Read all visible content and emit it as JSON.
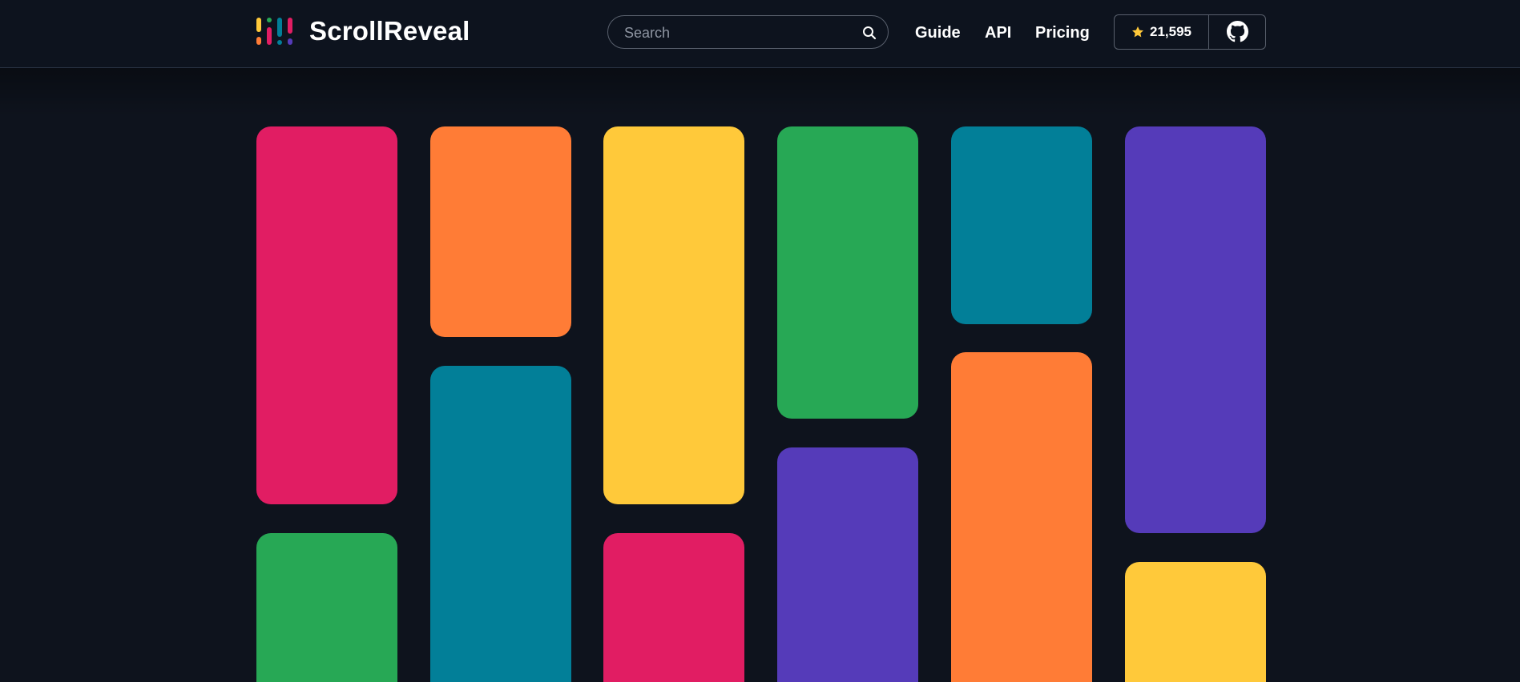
{
  "brand": {
    "name": "ScrollReveal",
    "logo_icon": "scrollreveal-logo-icon"
  },
  "search": {
    "placeholder": "Search",
    "value": "",
    "icon": "search-icon"
  },
  "nav": {
    "items": [
      {
        "label": "Guide"
      },
      {
        "label": "API"
      },
      {
        "label": "Pricing"
      }
    ]
  },
  "github": {
    "stars": "21,595",
    "star_icon": "star-icon",
    "link_icon": "github-icon"
  },
  "colors": {
    "background": "#0e131d",
    "pink": "#e11d63",
    "orange": "#ff7c36",
    "yellow": "#ffc93a",
    "green": "#27a855",
    "teal": "#027f98",
    "purple": "#553bb9"
  },
  "tiles": [
    [
      "pink",
      "green"
    ],
    [
      "orange",
      "teal"
    ],
    [
      "yellow",
      "pink"
    ],
    [
      "green",
      "purple"
    ],
    [
      "teal",
      "orange"
    ],
    [
      "purple",
      "yellow"
    ]
  ]
}
